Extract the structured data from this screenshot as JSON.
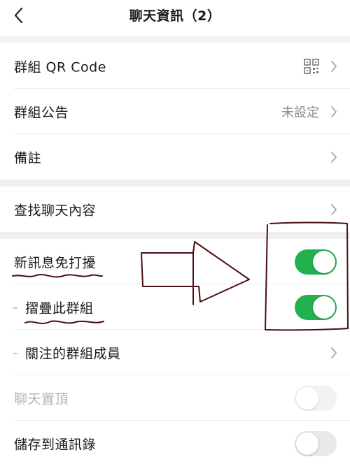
{
  "header": {
    "title": "聊天資訊（2）",
    "back_icon": "chevron-left-icon"
  },
  "rows": {
    "qr_code": {
      "label": "群組 QR Code",
      "icon": "qr-code-icon"
    },
    "announcement": {
      "label": "群組公告",
      "value": "未設定"
    },
    "remark": {
      "label": "備註"
    },
    "search_chat": {
      "label": "查找聊天內容"
    },
    "mute": {
      "label": "新訊息免打擾",
      "toggle": true
    },
    "collapse": {
      "prefix": "–",
      "label": "摺疊此群組",
      "toggle": true
    },
    "watch_members": {
      "prefix": "–",
      "label": "關注的群組成員"
    },
    "pin_top": {
      "label": "聊天置頂",
      "toggle": false,
      "disabled": true
    },
    "save_contacts": {
      "label": "儲存到通訊錄",
      "toggle": false
    }
  },
  "colors": {
    "toggle_on": "#22b14c",
    "toggle_off": "#e9e9e9",
    "annotation_ink": "#4a0f12"
  }
}
